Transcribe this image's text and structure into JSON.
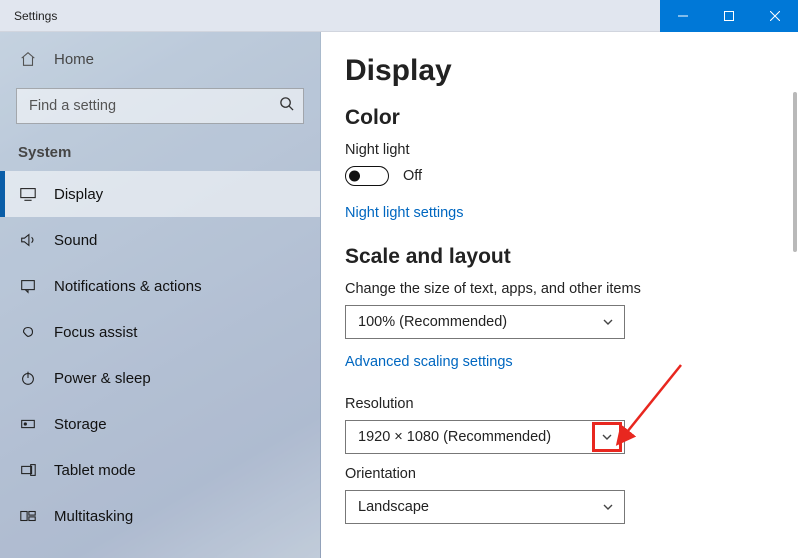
{
  "window": {
    "title": "Settings"
  },
  "sidebar": {
    "home_label": "Home",
    "search_placeholder": "Find a setting",
    "section_label": "System",
    "items": [
      {
        "label": "Display"
      },
      {
        "label": "Sound"
      },
      {
        "label": "Notifications & actions"
      },
      {
        "label": "Focus assist"
      },
      {
        "label": "Power & sleep"
      },
      {
        "label": "Storage"
      },
      {
        "label": "Tablet mode"
      },
      {
        "label": "Multitasking"
      }
    ]
  },
  "main": {
    "title": "Display",
    "color": {
      "heading": "Color",
      "night_light_label": "Night light",
      "night_light_state": "Off",
      "night_light_settings_link": "Night light settings"
    },
    "scale": {
      "heading": "Scale and layout",
      "size_label": "Change the size of text, apps, and other items",
      "size_value": "100% (Recommended)",
      "advanced_link": "Advanced scaling settings",
      "resolution_label": "Resolution",
      "resolution_value": "1920 × 1080 (Recommended)",
      "orientation_label": "Orientation",
      "orientation_value": "Landscape"
    }
  }
}
